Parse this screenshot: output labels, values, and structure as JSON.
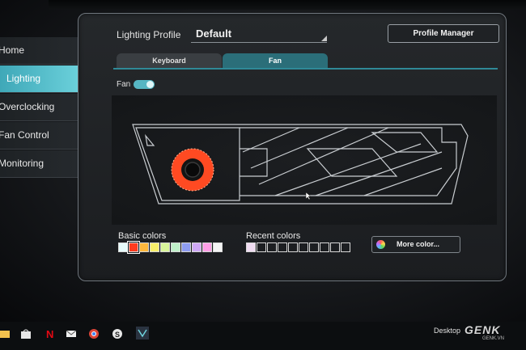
{
  "header": {
    "profile_label": "Lighting Profile",
    "profile_value": "Default",
    "profile_manager_label": "Profile Manager"
  },
  "sidebar": {
    "items": [
      {
        "label": "Home"
      },
      {
        "label": "Lighting",
        "active": true
      },
      {
        "label": "Overclocking"
      },
      {
        "label": "Fan Control"
      },
      {
        "label": "Monitoring"
      }
    ]
  },
  "tabs": [
    {
      "label": "Keyboard"
    },
    {
      "label": "Fan",
      "active": true
    }
  ],
  "fan_toggle": {
    "label": "Fan",
    "on": true
  },
  "basic_colors": {
    "label": "Basic colors",
    "swatches": [
      "#e6fbfb",
      "#ff3b1f",
      "#ffb83c",
      "#f7ef6a",
      "#d8f59a",
      "#bff0c9",
      "#8e9cf0",
      "#cfa8f5",
      "#ff9fe6",
      "#f4f4f4"
    ],
    "selected_index": 1
  },
  "recent_colors": {
    "label": "Recent colors",
    "swatches": [
      "#f0dcf2",
      "",
      "",
      "",
      "",
      "",
      "",
      "",
      "",
      ""
    ]
  },
  "more_color": {
    "label": "More color..."
  },
  "taskbar": {
    "desktop_label": "Desktop",
    "watermark": "GENK",
    "watermark_sub": "GENK.VN"
  },
  "colors": {
    "accent": "#6fd4de",
    "fan_ring": "#ff4a22",
    "tab_active": "#2b6e79"
  }
}
